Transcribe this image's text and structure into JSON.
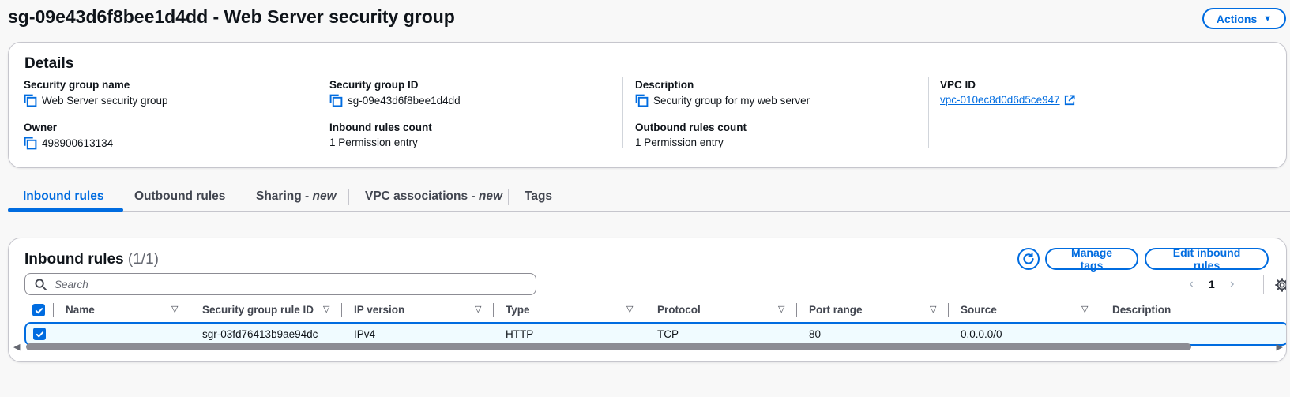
{
  "header": {
    "title": "sg-09e43d6f8bee1d4dd - Web Server security group",
    "actions_label": "Actions"
  },
  "details": {
    "title": "Details",
    "security_group_name": {
      "label": "Security group name",
      "value": "Web Server security group"
    },
    "security_group_id": {
      "label": "Security group ID",
      "value": "sg-09e43d6f8bee1d4dd"
    },
    "description": {
      "label": "Description",
      "value": "Security group for my web server"
    },
    "vpc_id": {
      "label": "VPC ID",
      "value": "vpc-010ec8d0d6d5ce947"
    },
    "owner": {
      "label": "Owner",
      "value": "498900613134"
    },
    "inbound_rules_count": {
      "label": "Inbound rules count",
      "value": "1 Permission entry"
    },
    "outbound_rules_count": {
      "label": "Outbound rules count",
      "value": "1 Permission entry"
    }
  },
  "tabs": [
    {
      "label": "Inbound rules",
      "suffix": "",
      "active": true
    },
    {
      "label": "Outbound rules",
      "suffix": ""
    },
    {
      "label": "Sharing - ",
      "suffix": "new"
    },
    {
      "label": "VPC associations - ",
      "suffix": "new"
    },
    {
      "label": "Tags",
      "suffix": ""
    }
  ],
  "inbound": {
    "title": "Inbound rules",
    "count": "(1/1)",
    "manage_tags_label": "Manage tags",
    "edit_label": "Edit inbound rules",
    "search_placeholder": "Search",
    "page": "1",
    "columns": [
      "Name",
      "Security group rule ID",
      "IP version",
      "Type",
      "Protocol",
      "Port range",
      "Source",
      "Description"
    ],
    "rows": [
      {
        "selected": true,
        "cells": [
          "–",
          "sgr-03fd76413b9ae94dc",
          "IPv4",
          "HTTP",
          "TCP",
          "80",
          "0.0.0.0/0",
          "–"
        ]
      }
    ]
  },
  "colors": {
    "accent": "#006ce0",
    "selected_row_bg": "#f0fbff"
  }
}
